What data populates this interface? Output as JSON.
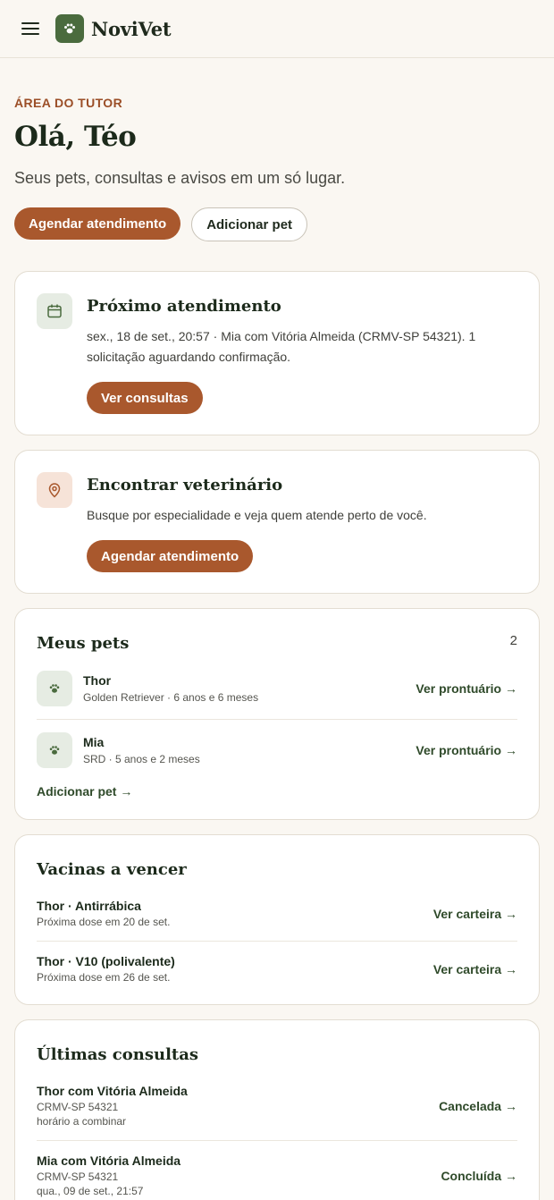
{
  "app": {
    "name": "NoviVet"
  },
  "header": {
    "menu_icon": "hamburger-menu-icon",
    "logo_icon": "paw-icon"
  },
  "hero": {
    "eyebrow": "ÁREA DO TUTOR",
    "title": "Olá, Téo",
    "subtitle": "Seus pets, consultas e avisos em um só lugar.",
    "primary_cta": "Agendar atendimento",
    "secondary_cta": "Adicionar pet"
  },
  "next_appointment": {
    "icon": "calendar-icon",
    "title": "Próximo atendimento",
    "text": "sex., 18 de set., 20:57 · Mia com Vitória Almeida (CRMV-SP 54321). 1 solicitação aguardando confirmação.",
    "button": "Ver consultas"
  },
  "find_vet": {
    "icon": "map-pin-icon",
    "title": "Encontrar veterinário",
    "text": "Busque por especialidade e veja quem atende perto de você.",
    "button": "Agendar atendimento"
  },
  "pets": {
    "title": "Meus pets",
    "count": "2",
    "items": [
      {
        "name": "Thor",
        "meta": "Golden Retriever · 6 anos e 6 meses",
        "link": "Ver prontuário →"
      },
      {
        "name": "Mia",
        "meta": "SRD · 5 anos e 2 meses",
        "link": "Ver prontuário →"
      }
    ],
    "add_link": "Adicionar pet →"
  },
  "vaccines": {
    "title": "Vacinas a vencer",
    "items": [
      {
        "name": "Thor · Antirrábica",
        "due": "Próxima dose em 20 de set.",
        "link": "Ver carteira →"
      },
      {
        "name": "Thor · V10 (polivalente)",
        "due": "Próxima dose em 26 de set.",
        "link": "Ver carteira →"
      }
    ]
  },
  "consultations": {
    "title": "Últimas consultas",
    "items": [
      {
        "name": "Thor com Vitória Almeida",
        "crmv": "CRMV-SP 54321",
        "when": "horário a combinar",
        "status": "Cancelada →"
      },
      {
        "name": "Mia com Vitória Almeida",
        "crmv": "CRMV-SP 54321",
        "when": "qua., 09 de set., 21:57",
        "status": "Concluída →"
      }
    ]
  },
  "colors": {
    "brand_green": "#4a6b3e",
    "accent": "#a9582d",
    "background": "#faf7f2"
  }
}
